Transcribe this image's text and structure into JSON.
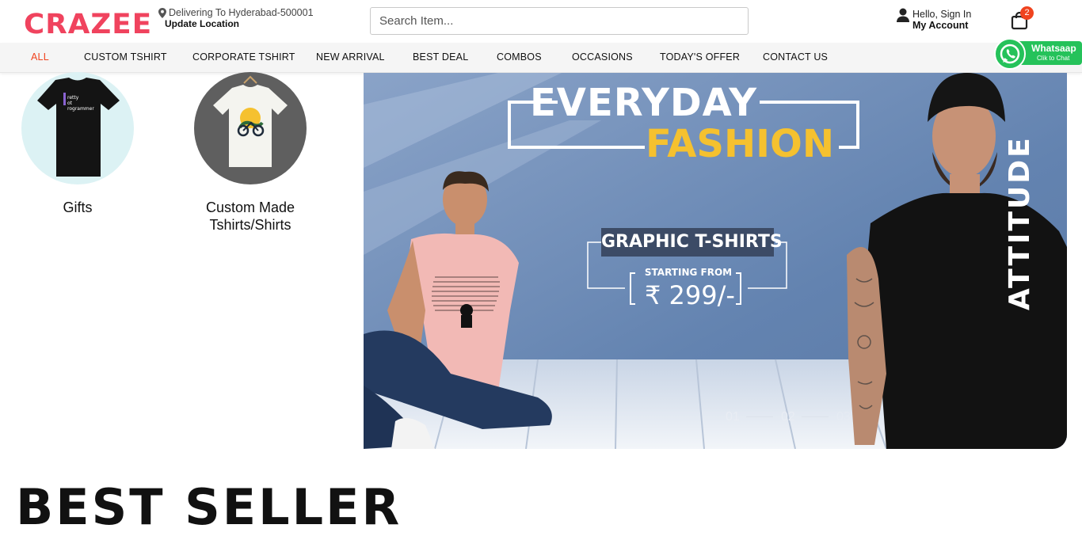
{
  "header": {
    "logo": "CRAZEE",
    "location_line": "Delivering To Hyderabad-500001",
    "update_location": "Update Location",
    "search_placeholder": "Search Item...",
    "greeting": "Hello, Sign In",
    "account": "My Account",
    "cart_count": "2"
  },
  "nav": {
    "items": [
      "ALL",
      "CUSTOM TSHIRT",
      "CORPORATE TSHIRT",
      "NEW ARRIVAL",
      "BEST DEAL",
      "COMBOS",
      "OCCASIONS",
      "TODAY'S OFFER",
      "CONTACT US"
    ],
    "active_color": "#f0431e"
  },
  "whatsapp": {
    "title": "Whatsaap",
    "subtitle": "Clik to Chat"
  },
  "categories": [
    {
      "label": "Gifts",
      "shirt_print": "retty\not\nrogrammer"
    },
    {
      "label_line1": "Custom Made",
      "label_line2": "Tshirts/Shirts"
    }
  ],
  "banner": {
    "title1": "EVERYDAY",
    "title2": "FASHION",
    "graphic": "GRAPHIC T-SHIRTS",
    "starting_from": "STARTING FROM",
    "price": "₹ 299/-",
    "side_text": "ATTITUDE",
    "slides": [
      "01",
      "02",
      "03"
    ]
  },
  "section_title": "BEST SELLER",
  "colors": {
    "brand": "#f0435e",
    "whatsapp": "#25c25a",
    "banner_bg": "#6d8bb4",
    "accent_yellow": "#f5c12f"
  }
}
